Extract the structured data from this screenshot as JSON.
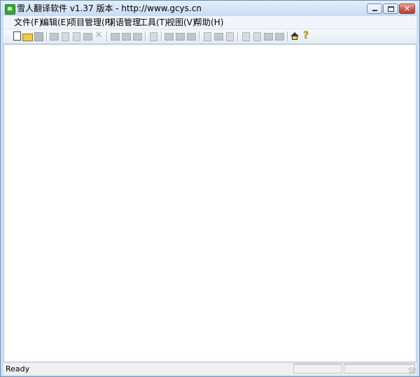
{
  "window": {
    "title": "雪人翻译软件 v1.37 版本 - http://www.gcys.cn",
    "close_glyph": "✕"
  },
  "menu": {
    "items": [
      "文件(F)",
      "编辑(E)",
      "项目管理(P)",
      "词语管理",
      "工具(T)",
      "视图(V)",
      "帮助(H)"
    ]
  },
  "toolbar": {
    "icons": [
      "new-file-icon",
      "open-folder-icon",
      "save-icon",
      "find-icon",
      "cut-icon",
      "copy-icon",
      "paste-icon",
      "delete-icon",
      "project-new-icon",
      "project-open-icon",
      "project-save-icon",
      "edit-doc-icon",
      "term-add-icon",
      "term-remove-icon",
      "term-edit-icon",
      "import-icon",
      "export-icon",
      "send-icon",
      "view-a-icon",
      "view-b-icon",
      "view-c-icon",
      "view-d-icon",
      "home-icon",
      "help-icon"
    ],
    "x_glyph": "✕",
    "help_glyph": "?"
  },
  "status": {
    "text": "Ready"
  },
  "colors": {
    "frame": "#cfe0f3",
    "close_button": "#c85a49",
    "content_bg": "#ffffff"
  }
}
